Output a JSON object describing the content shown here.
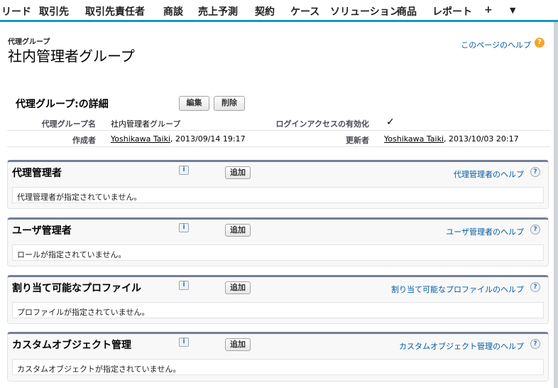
{
  "nav": {
    "tabs": [
      "リード",
      "取引先",
      "取引先責任者",
      "商談",
      "売上予測",
      "契約",
      "ケース",
      "ソリューション",
      "商品",
      "レポート"
    ],
    "plus": "+",
    "more": "▼"
  },
  "header": {
    "type_label": "代理グループ",
    "title": "社内管理者グループ",
    "help_link": "このページのヘルプ",
    "help_icon": "?"
  },
  "detail": {
    "title": "代理グループ:の詳細",
    "edit_button": "編集",
    "delete_button": "削除",
    "name_label": "代理グループ名",
    "name_value": "社内管理者グループ",
    "login_label": "ログインアクセスの有効化",
    "login_value": "✓",
    "created_label": "作成者",
    "created_user": "Yoshikawa Taiki",
    "created_date": ", 2013/09/14 19:17",
    "modified_label": "更新者",
    "modified_user": "Yoshikawa Taiki",
    "modified_date": ", 2013/10/03 20:17"
  },
  "related": [
    {
      "title": "代理管理者",
      "info": "i",
      "add": "追加",
      "help": "代理管理者のヘルプ",
      "help_icon": "?",
      "empty": "代理管理者が指定されていません。"
    },
    {
      "title": "ユーザ管理者",
      "info": "i",
      "add": "追加",
      "help": "ユーザ管理者のヘルプ",
      "help_icon": "?",
      "empty": "ロールが指定されていません。"
    },
    {
      "title": "割り当て可能なプロファイル",
      "info": "i",
      "add": "追加",
      "help": "割り当て可能なプロファイルのヘルプ",
      "help_icon": "?",
      "empty": "プロファイルが指定されていません。"
    },
    {
      "title": "カスタムオブジェクト管理",
      "info": "i",
      "add": "追加",
      "help": "カスタムオブジェクト管理のヘルプ",
      "help_icon": "?",
      "empty": "カスタムオブジェクトが指定されていません。"
    }
  ],
  "colors": {
    "tab_accent": "#1797c0",
    "link": "#015ba7",
    "section_border": "#747e96",
    "help_orange": "#f5a623"
  }
}
